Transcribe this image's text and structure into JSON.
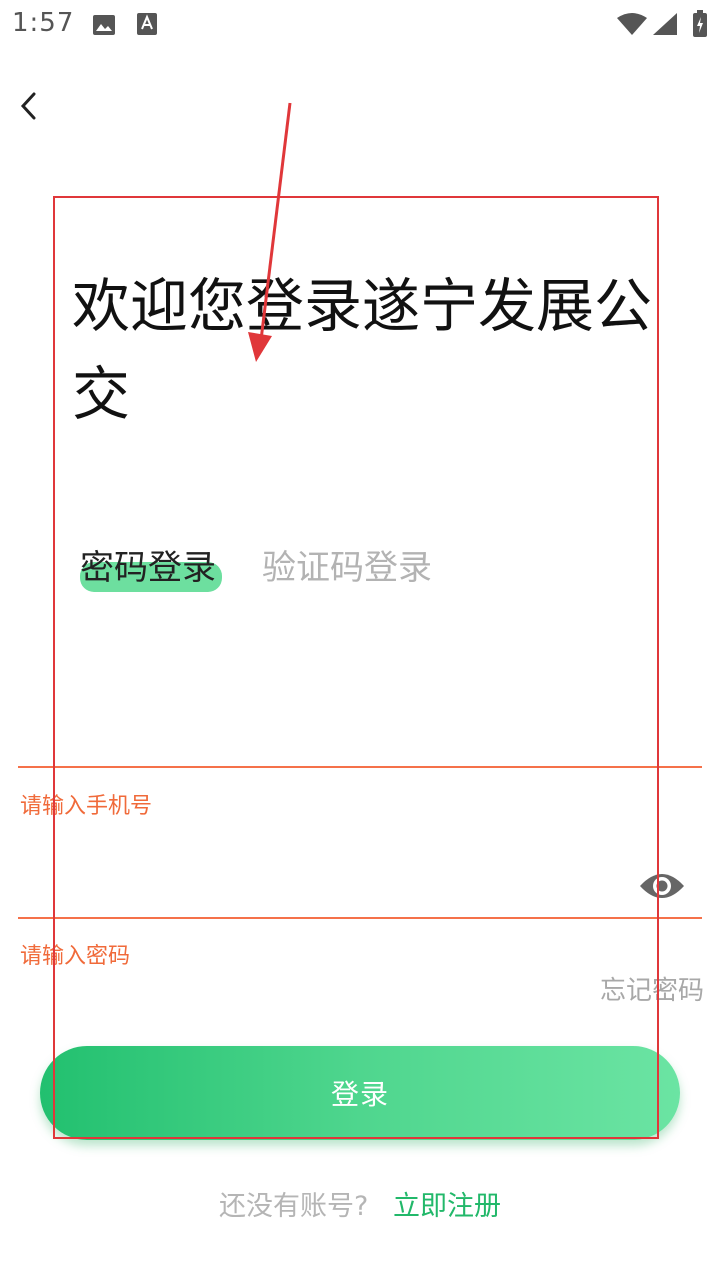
{
  "status_bar": {
    "time": "1:57",
    "icons": [
      "photo-icon",
      "a-icon",
      "wifi-icon",
      "signal-icon",
      "battery-icon"
    ]
  },
  "header": {
    "back_icon": "chevron-left-icon"
  },
  "title": "欢迎您登录遂宁发展公交",
  "tabs": [
    {
      "label": "密码登录",
      "active": true
    },
    {
      "label": "验证码登录",
      "active": false
    }
  ],
  "form": {
    "phone_hint": "请输入手机号",
    "phone_value": "",
    "password_hint": "请输入密码",
    "password_value": "",
    "toggle_icon": "eye-icon",
    "forgot_label": "忘记密码"
  },
  "login_button": {
    "label": "登录"
  },
  "register": {
    "prompt": "还没有账号?",
    "link": "立即注册"
  },
  "colors": {
    "accent": "#22c06f",
    "tab_highlight": "#6ddf9f",
    "error": "#f06a3a",
    "annotation": "#e0373a"
  }
}
